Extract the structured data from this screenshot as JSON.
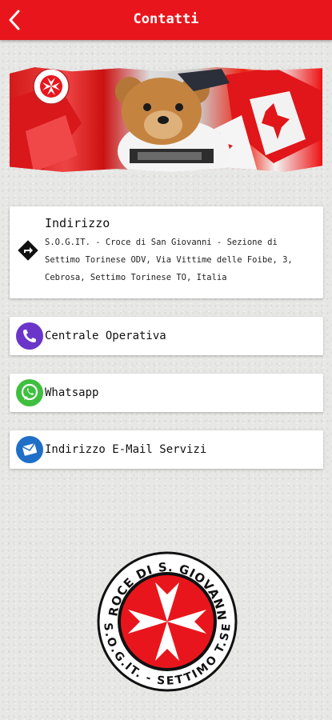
{
  "header": {
    "title": "Contatti",
    "back_icon": "chevron-left-icon"
  },
  "colors": {
    "primary": "#e8161c",
    "phone": "#6a35c9",
    "whatsapp": "#3fbf3f",
    "email": "#1f6fc8"
  },
  "banner": {
    "alt_text": "Mascot teddy bear banner"
  },
  "address": {
    "title": "Indirizzo",
    "text": "S.O.G.IT. - Croce di San Giovanni - Sezione di Settimo Torinese ODV, Via Vittime delle Foibe, 3, Cebrosa, Settimo Torinese TO, Italia"
  },
  "contacts": [
    {
      "label": "Centrale Operativa",
      "icon": "phone-icon"
    },
    {
      "label": "Whatsapp",
      "icon": "whatsapp-icon"
    },
    {
      "label": "Indirizzo E-Mail Servizi",
      "icon": "email-icon"
    }
  ],
  "logo": {
    "top_text": "CROCE DI S. GIOVANNI",
    "bottom_text": "S.O.G.IT. - SETTIMO T.SE"
  }
}
